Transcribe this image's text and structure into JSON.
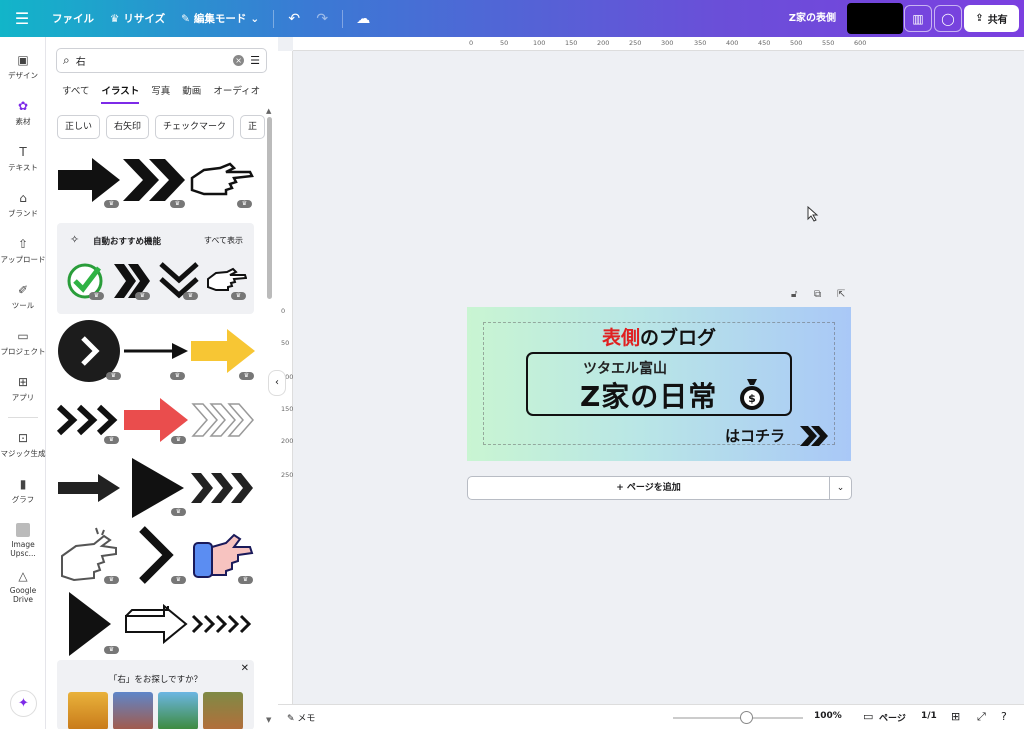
{
  "topbar": {
    "file": "ファイル",
    "resize": "リサイズ",
    "edit_mode": "編集モード",
    "doc_title": "Z家の表側",
    "share": "共有"
  },
  "rail": [
    {
      "label": "デザイン",
      "icon": "layout-icon"
    },
    {
      "label": "素材",
      "icon": "elements-icon",
      "active": true
    },
    {
      "label": "テキスト",
      "icon": "text-icon"
    },
    {
      "label": "ブランド",
      "icon": "brand-icon"
    },
    {
      "label": "アップロード",
      "icon": "upload-icon"
    },
    {
      "label": "ツール",
      "icon": "tools-icon"
    },
    {
      "label": "プロジェクト",
      "icon": "folder-icon"
    },
    {
      "label": "アプリ",
      "icon": "apps-icon"
    },
    {
      "label": "マジック生成",
      "icon": "magic-icon"
    },
    {
      "label": "グラフ",
      "icon": "chart-icon"
    },
    {
      "label": "Image Upsc...",
      "icon": "upscale-icon"
    },
    {
      "label": "Google Drive",
      "icon": "drive-icon"
    }
  ],
  "panel": {
    "search_value": "右",
    "tabs": [
      "すべて",
      "イラスト",
      "写真",
      "動画",
      "オーディオ"
    ],
    "active_tab": "イラスト",
    "chips": [
      "正しい",
      "右矢印",
      "チェックマーク",
      "正"
    ],
    "auto_title": "自動おすすめ機能",
    "auto_all": "すべて表示",
    "suggest_title": "「右」をお探しですか？"
  },
  "design": {
    "title_red": "表側",
    "title_rest": "のブログ",
    "sub": "ツタエル富山",
    "main": "Z家の日常",
    "link": "はコチラ"
  },
  "canvas": {
    "add_page": "+ ページを追加",
    "hruler": [
      "0",
      "50",
      "100",
      "150",
      "200",
      "250",
      "300",
      "350",
      "400",
      "450",
      "500",
      "550",
      "600"
    ],
    "vruler": [
      "0",
      "50",
      "100",
      "150",
      "200",
      "250"
    ]
  },
  "bottombar": {
    "memo": "メモ",
    "zoom": "100%",
    "pages_label": "ページ",
    "page_count": "1/1"
  }
}
